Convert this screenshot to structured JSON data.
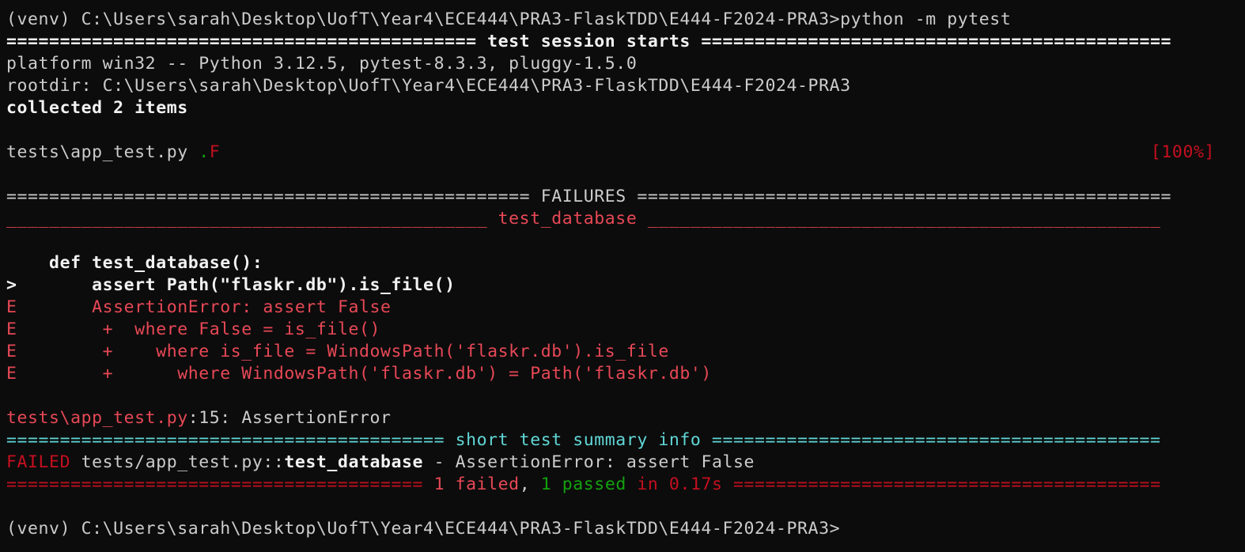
{
  "terminal": {
    "prompt_start": "(venv) C:\\Users\\sarah\\Desktop\\UofT\\Year4\\ECE444\\PRA3-FlaskTDD\\E444-F2024-PRA3>",
    "command": "python -m pytest",
    "session_header": "============================================ test session starts ============================================",
    "platform_line": "platform win32 -- Python 3.12.5, pytest-8.3.3, pluggy-1.5.0",
    "rootdir_line": "rootdir: C:\\Users\\sarah\\Desktop\\UofT\\Year4\\ECE444\\PRA3-FlaskTDD\\E444-F2024-PRA3",
    "collected_line": "collected 2 items",
    "test_file": "tests\\app_test.py ",
    "test_results": ".F",
    "progress": "[100%]",
    "failures_header": "================================================= FAILURES ==================================================",
    "test_name_header": "_____________________________________________ test_database ________________________________________________",
    "code_def": "    def test_database():",
    "code_marker": ">",
    "code_assert": "       assert Path(\"flaskr.db\").is_file()",
    "error_marker": "E",
    "error_lines": [
      "       AssertionError: assert False",
      "        +  where False = is_file()",
      "        +    where is_file = WindowsPath('flaskr.db').is_file",
      "        +      where WindowsPath('flaskr.db') = Path('flaskr.db')"
    ],
    "location_file": "tests\\app_test.py",
    "location_rest": ":15: AssertionError",
    "summary_header": "========================================= short test summary info ==========================================",
    "failed_label": "FAILED",
    "failed_path": " tests/app_test.py::",
    "failed_test": "test_database",
    "failed_msg": " - AssertionError: assert False",
    "final_left": "======================================= ",
    "final_failed": "1 failed",
    "final_comma": ", ",
    "final_passed": "1 passed",
    "final_time": " in 0.17s ",
    "final_right": "========================================",
    "prompt_end": "(venv) C:\\Users\\sarah\\Desktop\\UofT\\Year4\\ECE444\\PRA3-FlaskTDD\\E444-F2024-PRA3>"
  },
  "colors": {
    "background": "#0c0c0c",
    "foreground": "#cccccc",
    "red": "#e74856",
    "dark_red": "#c50f1f",
    "green": "#13a10e",
    "cyan": "#61d6d6"
  }
}
